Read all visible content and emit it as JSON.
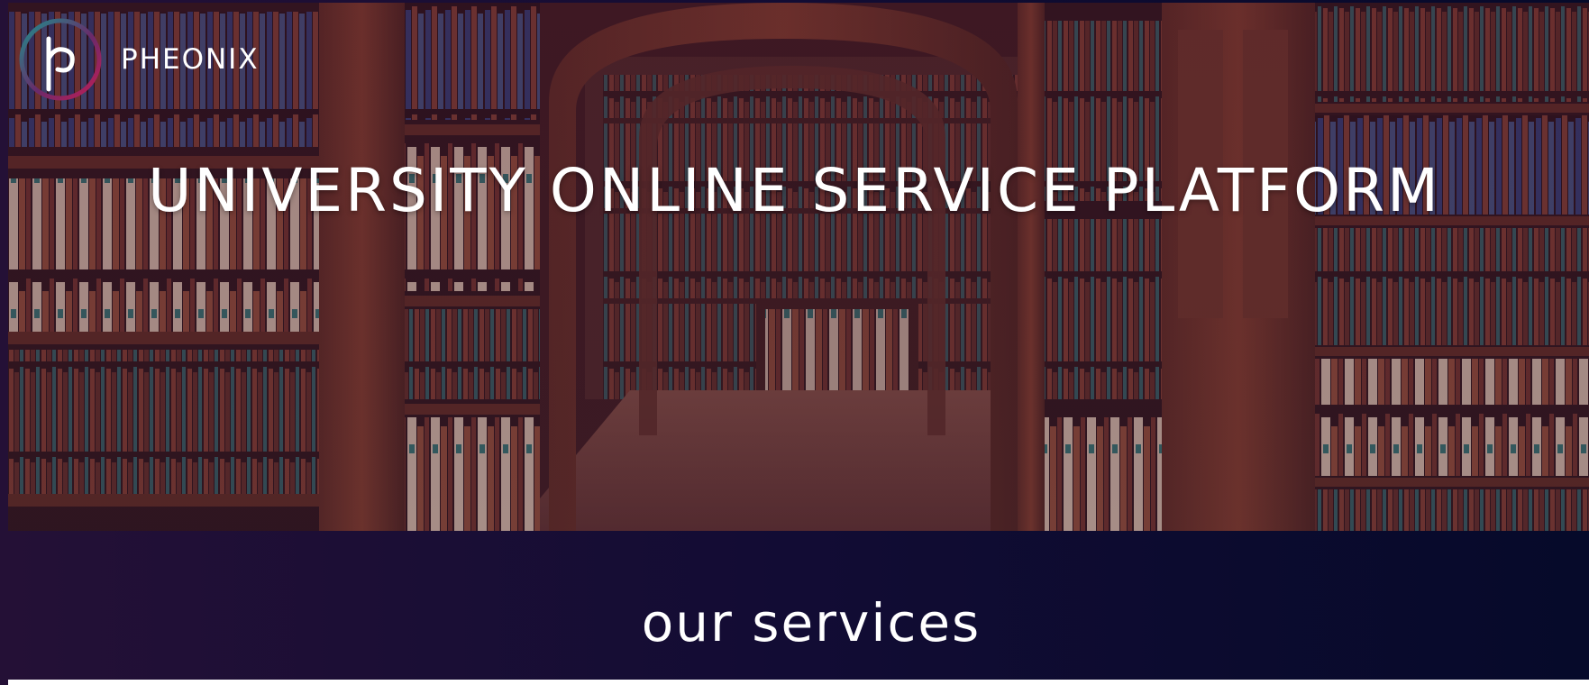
{
  "brand": {
    "name": "PHEONIX",
    "logo_icon": "pheonix-p-ring-logo"
  },
  "hero": {
    "title": "UNIVERSITY ONLINE SERVICE PLATFORM",
    "background": "library-bookshelves-archway-photo"
  },
  "services": {
    "heading": "our services"
  },
  "colors": {
    "band_left": "#241036",
    "band_right": "#060a2a",
    "logo_ring_teal": "#1f8f8c",
    "logo_ring_crimson": "#c21d55",
    "text": "#ffffff"
  }
}
